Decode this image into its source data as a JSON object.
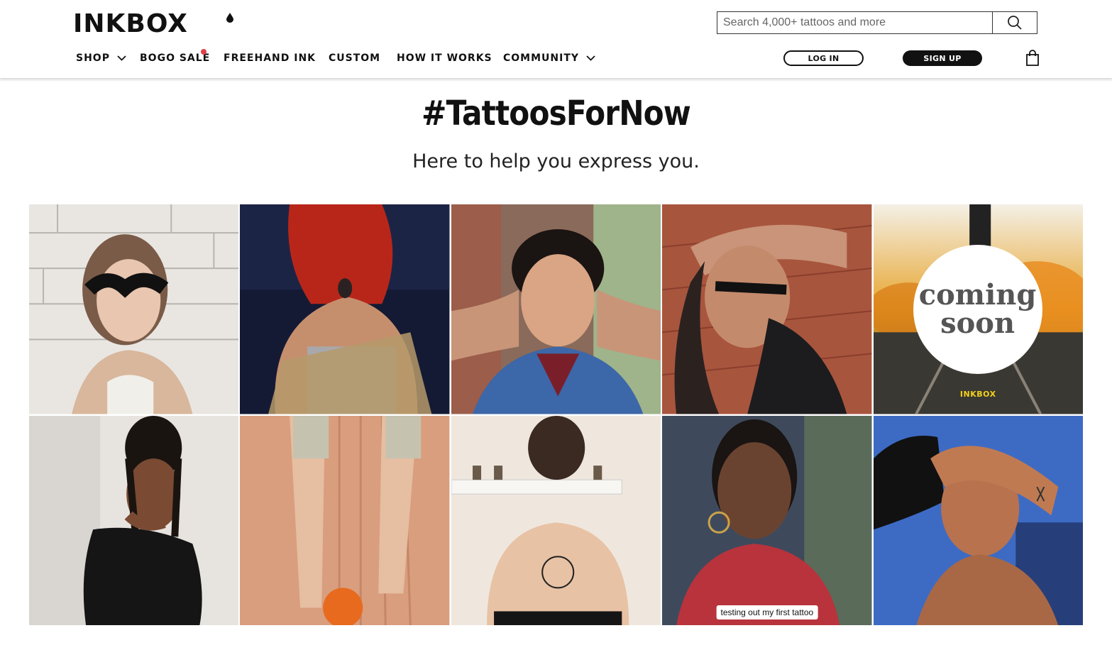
{
  "header": {
    "logo": "INKBOX",
    "search": {
      "placeholder": "Search 4,000+ tattoos and more"
    },
    "nav": [
      "SHOP",
      "BOGO SALE",
      "FREEHAND INK",
      "CUSTOM",
      "HOW IT WORKS",
      "COMMUNITY"
    ],
    "login_label": "LOG IN",
    "signup_label": "SIGN UP"
  },
  "main": {
    "title": "#TattoosForNow",
    "subtitle": "Here to help you express you.",
    "gallery": [
      {
        "caption": ""
      },
      {
        "caption": ""
      },
      {
        "caption": ""
      },
      {
        "caption": ""
      },
      {
        "overlay_line1": "coming",
        "overlay_line2": "soon",
        "brand": "INKBOX"
      },
      {
        "caption": ""
      },
      {
        "caption": ""
      },
      {
        "caption": ""
      },
      {
        "caption": "testing out my first tattoo"
      },
      {
        "caption": ""
      }
    ]
  },
  "colors": {
    "sale_dot": "#e0404c",
    "brand_yellow": "#f2d01c"
  }
}
